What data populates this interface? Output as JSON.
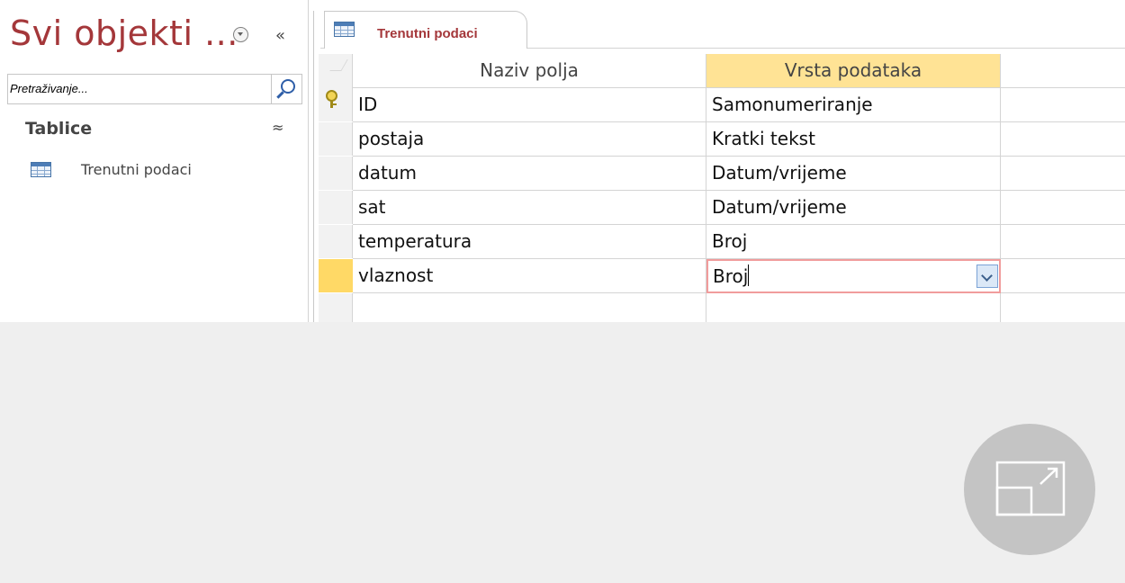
{
  "nav": {
    "title": "Svi objekti ...",
    "search_placeholder": "Pretraživanje...",
    "group_label": "Tablice",
    "items": [
      {
        "label": "Trenutni podaci",
        "icon": "table-icon"
      }
    ]
  },
  "document": {
    "tab_label": "Trenutni podaci",
    "tab_icon": "table-icon"
  },
  "grid": {
    "headers": {
      "field_name": "Naziv polja",
      "data_type": "Vrsta podataka",
      "description": ""
    },
    "rows": [
      {
        "field": "ID",
        "type": "Samonumeriranje",
        "primary_key": true
      },
      {
        "field": "postaja",
        "type": "Kratki tekst"
      },
      {
        "field": "datum",
        "type": "Datum/vrijeme"
      },
      {
        "field": "sat",
        "type": "Datum/vrijeme"
      },
      {
        "field": "temperatura",
        "type": "Broj"
      },
      {
        "field": "vlaznost",
        "type": "Broj",
        "active": true
      }
    ]
  },
  "colors": {
    "title_accent": "#a4373a",
    "header_highlight": "#ffe395",
    "row_selector_active": "#ffd966",
    "edit_border": "#f19c9c"
  },
  "overlay": {
    "icon": "expand-icon"
  }
}
